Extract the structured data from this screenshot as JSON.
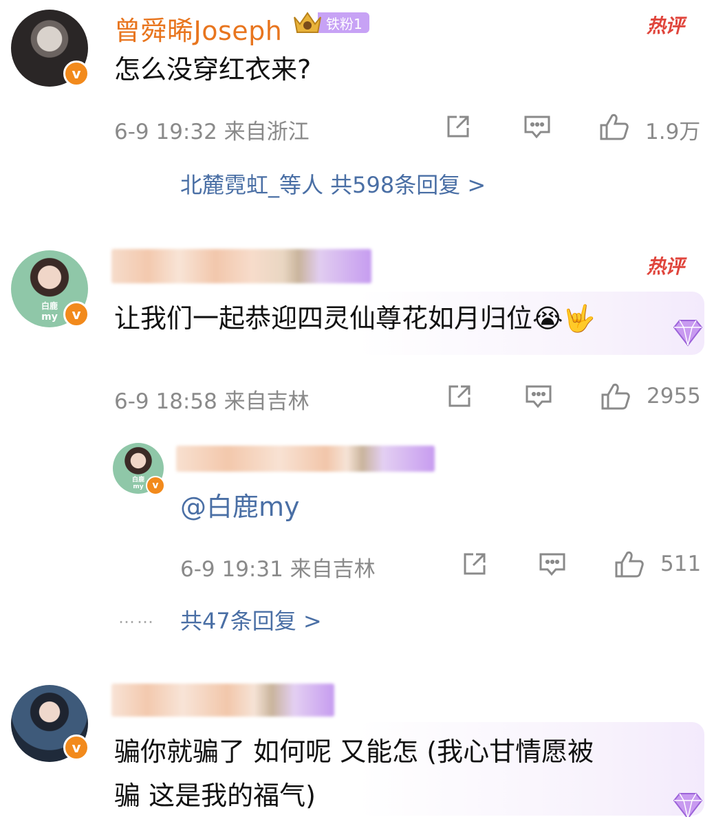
{
  "comments": [
    {
      "username": "曾舜晞Joseph",
      "fan_badge": "铁粉1",
      "hot_label": "热评",
      "content": "怎么没穿红衣来?",
      "meta": "6-9 19:32 来自浙江",
      "likes": "1.9万",
      "reply_summary": "北麓霓虹_等人 共598条回复 >"
    },
    {
      "hot_label": "热评",
      "content": "让我们一起恭迎四灵仙尊花如月归位😭🤟",
      "meta": "6-9 18:58 来自吉林",
      "likes": "2955",
      "reply": {
        "content": "@白鹿my",
        "meta": "6-9 19:31 来自吉林",
        "likes": "511"
      },
      "reply_summary": "共47条回复 >",
      "dots": "……"
    },
    {
      "content_line1": "骗你就骗了 如何呢 又能怎 (我心甘情愿被",
      "content_line2": "骗 这是我的福气)"
    }
  ],
  "verified_badge": "v",
  "avatar1_text": "白鹿",
  "avatar1_subtext": "my",
  "avatar2_text": "白鹿",
  "avatar2_subtext": "my",
  "icons": [
    "repost-icon",
    "comment-icon",
    "like-icon",
    "gem-icon",
    "crown-icon"
  ],
  "colors": {
    "username": "#e8751e",
    "link": "#4a6fa5",
    "hot": "#e0453c",
    "meta": "#8a8a8a",
    "badge": "#c7a2f5",
    "verified": "#f28a1c"
  }
}
